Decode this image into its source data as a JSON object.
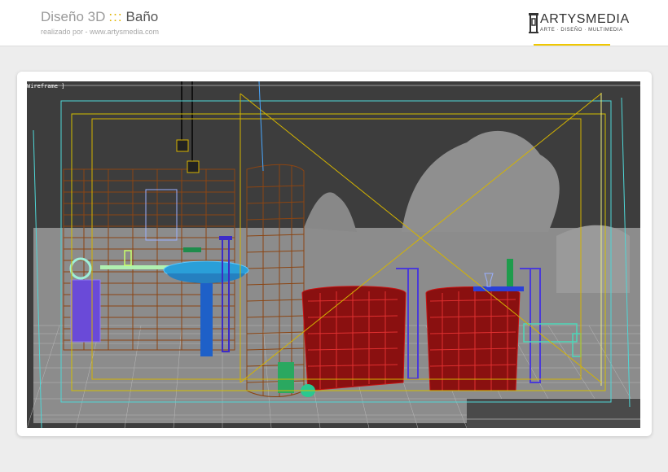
{
  "header": {
    "title_prefix": "Diseño 3D",
    "title_separator": ":::",
    "title_subject": "Baño",
    "subtitle": "realizado por - www.artysmedia.com"
  },
  "logo": {
    "name": "ARTYSMEDIA",
    "tagline": "ARTE · DISEÑO · MULTIMEDIA"
  },
  "viewport": {
    "label": "Wireframe ]"
  },
  "colors": {
    "accent": "#f0c800",
    "viewport_bg": "#3d3d3d",
    "wire_red": "#c81414",
    "wire_blue": "#1e7fd8",
    "wire_brown": "#8b4513",
    "wire_yellow": "#d4b400",
    "wire_cyan": "#4fd6d6"
  },
  "icons": [
    "artysmedia-logo-icon"
  ]
}
